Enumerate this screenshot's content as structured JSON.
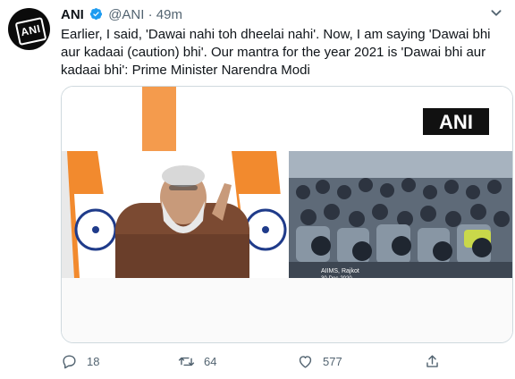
{
  "tweet": {
    "author_name": "ANI",
    "author_handle": "@ANI",
    "separator": "·",
    "timestamp": "49m",
    "text": "Earlier, I said, 'Dawai nahi toh dheelai nahi'. Now, I am saying 'Dawai bhi aur kadaai (caution) bhi'. Our mantra for the year 2021 is 'Dawai bhi aur kadaai bhi': Prime Minister Narendra Modi",
    "avatar_text": "ANI",
    "media": {
      "watermark": "ANI",
      "caption_line1": "AIIMS, Rajkot",
      "caption_line2": "30-Dec-2020"
    },
    "actions": {
      "reply_count": "18",
      "retweet_count": "64",
      "like_count": "577"
    }
  },
  "colors": {
    "verified_badge": "#1d9bf0",
    "secondary_text": "#536471",
    "media_border": "#cfd9de",
    "flag_saffron": "#f28a2e",
    "flag_green": "#3a8a3a",
    "chakra_blue": "#1f3b8a"
  },
  "icons": [
    "verified-badge-icon",
    "more-options-icon",
    "reply-icon",
    "retweet-icon",
    "like-icon",
    "share-icon"
  ]
}
